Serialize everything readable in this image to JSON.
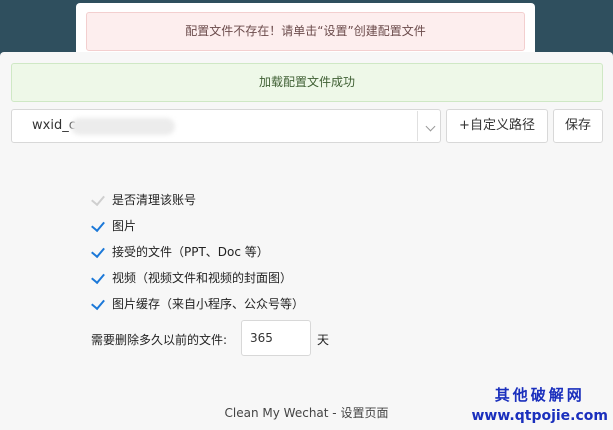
{
  "background_alert": {
    "text": "配置文件不存在！请单击“设置”创建配置文件"
  },
  "success_alert": {
    "text": "加载配置文件成功"
  },
  "path": {
    "value": "wxid_c"
  },
  "buttons": {
    "custom_path": "+自定义路径",
    "save": "保存"
  },
  "options": [
    {
      "label": "是否清理该账号",
      "checked": true,
      "disabled": true
    },
    {
      "label": "图片",
      "checked": true,
      "disabled": false
    },
    {
      "label": "接受的文件（PPT、Doc 等）",
      "checked": true,
      "disabled": false
    },
    {
      "label": "视频（视频文件和视频的封面图）",
      "checked": true,
      "disabled": false
    },
    {
      "label": "图片缓存（来自小程序、公众号等）",
      "checked": true,
      "disabled": false
    }
  ],
  "days": {
    "label": "需要删除多久以前的文件:",
    "value": "365",
    "unit": "天"
  },
  "footer": {
    "text": "Clean My Wechat - 设置页面"
  },
  "watermark": {
    "line1": "其他破解网",
    "line2": "www.qtpojie.com"
  },
  "colors": {
    "accent": "#1b78d8",
    "success_bg": "#eef8e8",
    "error_bg": "#fdeeee"
  }
}
